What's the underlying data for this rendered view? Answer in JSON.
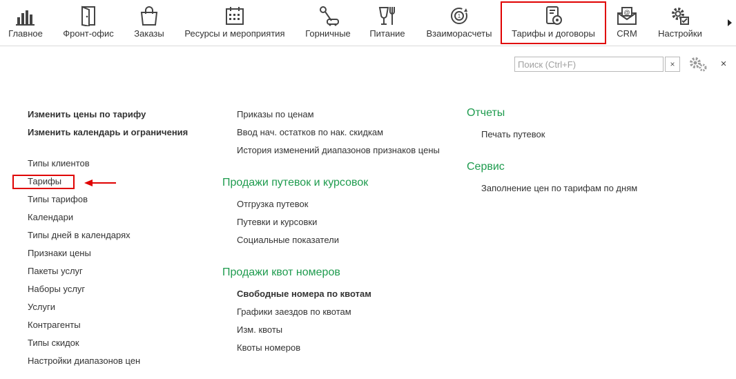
{
  "nav": {
    "items": [
      {
        "label": "Главное",
        "icon": "bar-chart-icon"
      },
      {
        "label": "Фронт-офис",
        "icon": "door-icon"
      },
      {
        "label": "Заказы",
        "icon": "shopping-bag-icon"
      },
      {
        "label": "Ресурсы и мероприятия",
        "icon": "calendar-icon"
      },
      {
        "label": "Горничные",
        "icon": "vacuum-cleaner-icon"
      },
      {
        "label": "Питание",
        "icon": "cup-fork-icon"
      },
      {
        "label": "Взаиморасчеты",
        "icon": "circular-arrows-icon"
      },
      {
        "label": "Тарифы и договоры",
        "icon": "document-coin-icon"
      },
      {
        "label": "CRM",
        "icon": "envelope-at-icon"
      },
      {
        "label": "Настройки",
        "icon": "gears-icon"
      }
    ]
  },
  "search": {
    "placeholder": "Поиск (Ctrl+F)",
    "value": "",
    "clear": "×"
  },
  "close": "×",
  "col1": {
    "bold_links": [
      "Изменить цены по тарифу",
      "Изменить календарь и ограничения"
    ],
    "links": [
      "Типы клиентов",
      "Тарифы",
      "Типы тарифов",
      "Календари",
      "Типы дней в календарях",
      "Признаки цены",
      "Пакеты услуг",
      "Наборы услуг",
      "Услуги",
      "Контрагенты",
      "Типы скидок",
      "Настройки диапазонов цен"
    ]
  },
  "col2": {
    "links": [
      "Приказы по ценам",
      "Ввод нач. остатков по нак. скидкам",
      "История изменений диапазонов признаков цены"
    ],
    "sales": {
      "title": "Продажи путевок и курсовок",
      "links": [
        "Отгрузка путевок",
        "Путевки и курсовки",
        "Социальные показатели"
      ]
    },
    "quotas": {
      "title": "Продажи квот номеров",
      "bold_link": "Свободные номера по квотам",
      "links": [
        "Графики заездов по квотам",
        "Изм. квоты",
        "Квоты номеров"
      ]
    }
  },
  "col3": {
    "reports": {
      "title": "Отчеты",
      "links": [
        "Печать путевок"
      ]
    },
    "service": {
      "title": "Сервис",
      "links": [
        "Заполнение цен по тарифам по дням"
      ]
    }
  },
  "colors": {
    "accent_green": "#1e9b4e",
    "highlight_red": "#e00000"
  }
}
